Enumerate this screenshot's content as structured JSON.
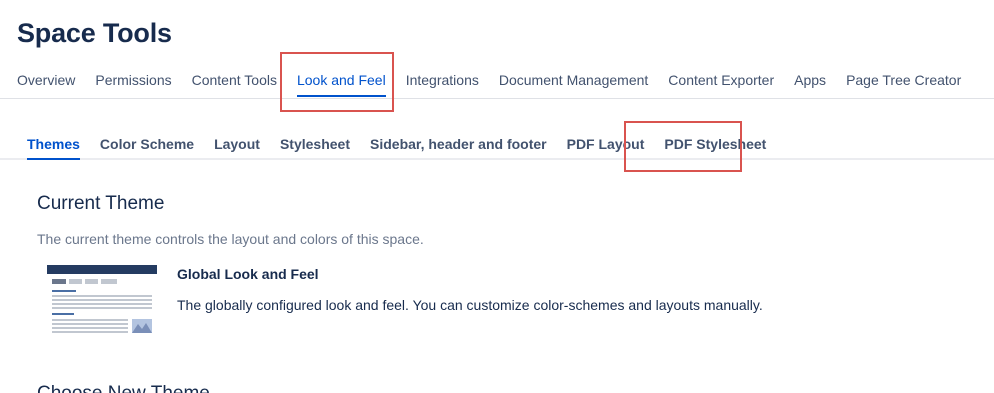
{
  "page": {
    "title": "Space Tools"
  },
  "primary_tabs": [
    {
      "label": "Overview",
      "active": false
    },
    {
      "label": "Permissions",
      "active": false
    },
    {
      "label": "Content Tools",
      "active": false
    },
    {
      "label": "Look and Feel",
      "active": true
    },
    {
      "label": "Integrations",
      "active": false
    },
    {
      "label": "Document Management",
      "active": false
    },
    {
      "label": "Content Exporter",
      "active": false
    },
    {
      "label": "Apps",
      "active": false
    },
    {
      "label": "Page Tree Creator",
      "active": false
    }
  ],
  "secondary_tabs": [
    {
      "label": "Themes",
      "active": true
    },
    {
      "label": "Color Scheme",
      "active": false
    },
    {
      "label": "Layout",
      "active": false
    },
    {
      "label": "Stylesheet",
      "active": false
    },
    {
      "label": "Sidebar, header and footer",
      "active": false
    },
    {
      "label": "PDF Layout",
      "active": false
    },
    {
      "label": "PDF Stylesheet",
      "active": false
    }
  ],
  "current_theme": {
    "heading": "Current Theme",
    "description": "The current theme controls the layout and colors of this space.",
    "theme_name": "Global Look and Feel",
    "theme_description": "The globally configured look and feel. You can customize color-schemes and layouts manually.",
    "thumbnail_icon": "theme-preview-thumbnail"
  },
  "next_section": {
    "heading": "Choose New Theme"
  },
  "colors": {
    "accent": "#0052cc",
    "heading": "#172b4d",
    "muted": "#6b778c",
    "highlight": "#d9534f"
  }
}
